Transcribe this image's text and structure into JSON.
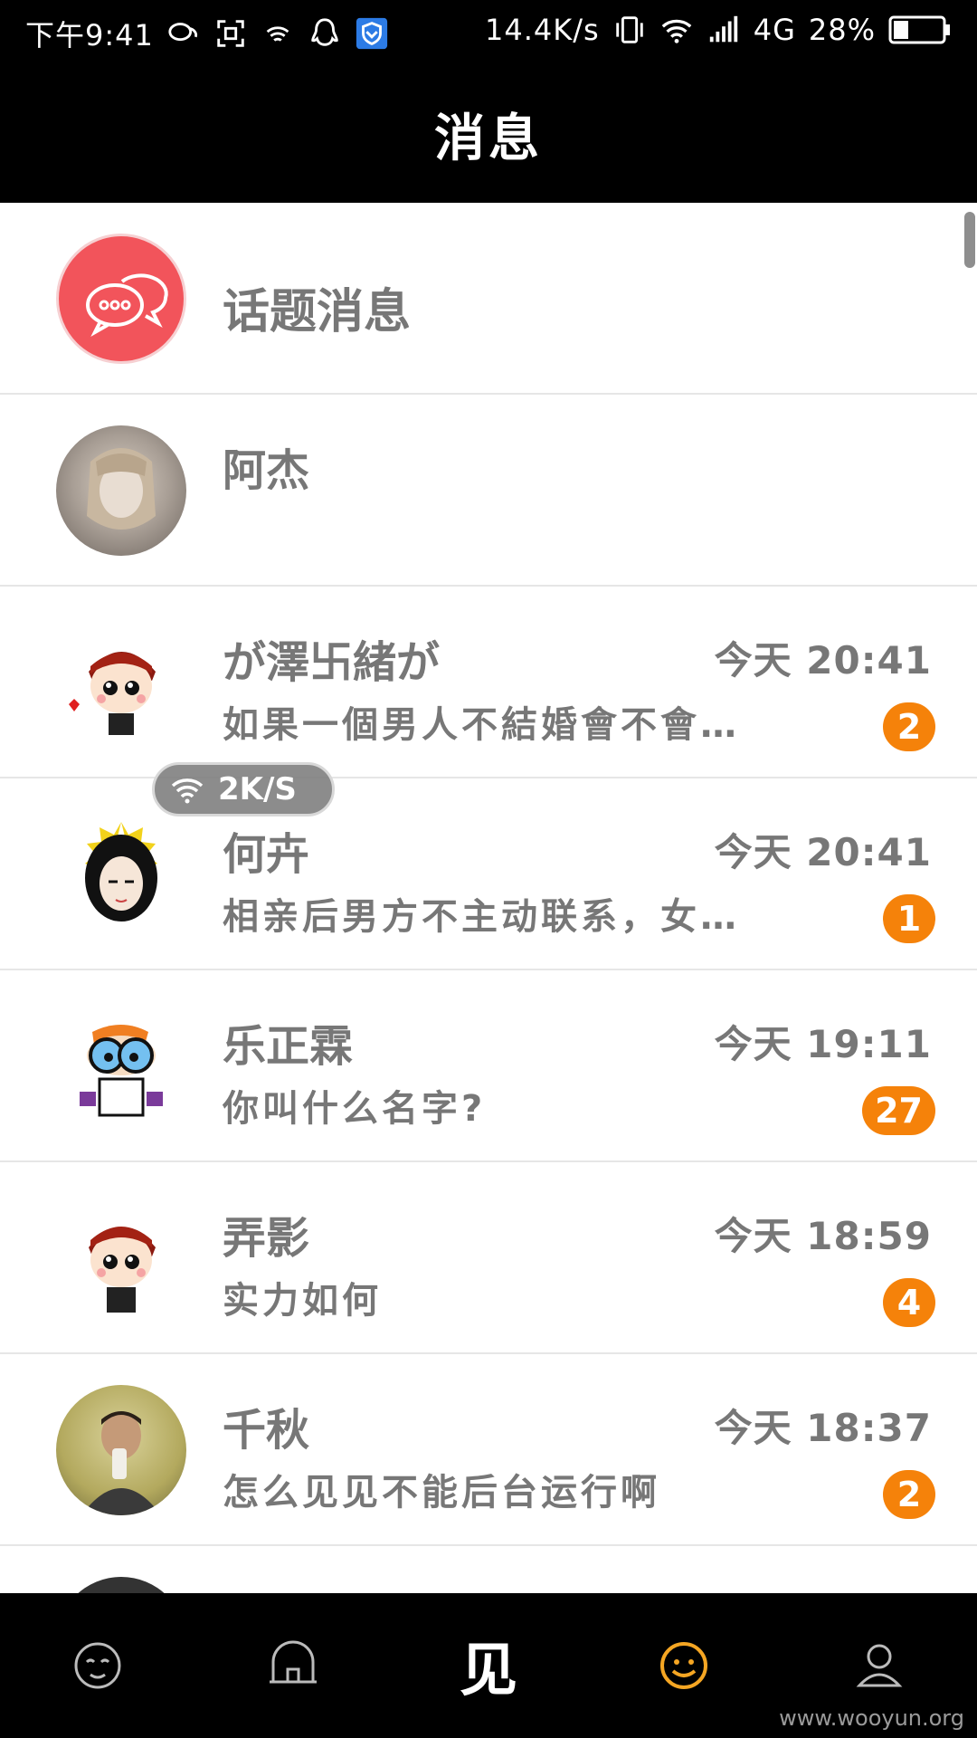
{
  "status_bar": {
    "time": "下午9:41",
    "net_speed": "14.4K/s",
    "network_type": "4G",
    "battery": "28%"
  },
  "header": {
    "title": "消息"
  },
  "topic_row": {
    "label": "话题消息",
    "icon": "chat-bubbles-icon",
    "color": "#f2545b"
  },
  "conversations": [
    {
      "name": "阿杰",
      "time": "",
      "preview": "",
      "badge": ""
    },
    {
      "name": "が澤卐緒が",
      "time": "今天  20:41",
      "preview": "如果一個男人不結婚會不會…",
      "badge": "2"
    },
    {
      "name": "何卉",
      "time": "今天  20:41",
      "preview": "相亲后男方不主动联系，女…",
      "badge": "1"
    },
    {
      "name": "乐正霖",
      "time": "今天  19:11",
      "preview": "你叫什么名字?",
      "badge": "27"
    },
    {
      "name": "弄影",
      "time": "今天  18:59",
      "preview": "实力如何",
      "badge": "4"
    },
    {
      "name": "千秋",
      "time": "今天  18:37",
      "preview": "怎么见见不能后台运行啊",
      "badge": "2"
    }
  ],
  "floating_speed": {
    "text": "2K/S"
  },
  "bottom_nav": {
    "items": [
      "face-icon",
      "home-icon",
      "见",
      "smile-face-icon",
      "profile-icon"
    ],
    "active_color": "#f5a623"
  },
  "watermark": "www.wooyun.org",
  "colors": {
    "badge": "#f5820a",
    "topic_icon": "#f2545b"
  }
}
